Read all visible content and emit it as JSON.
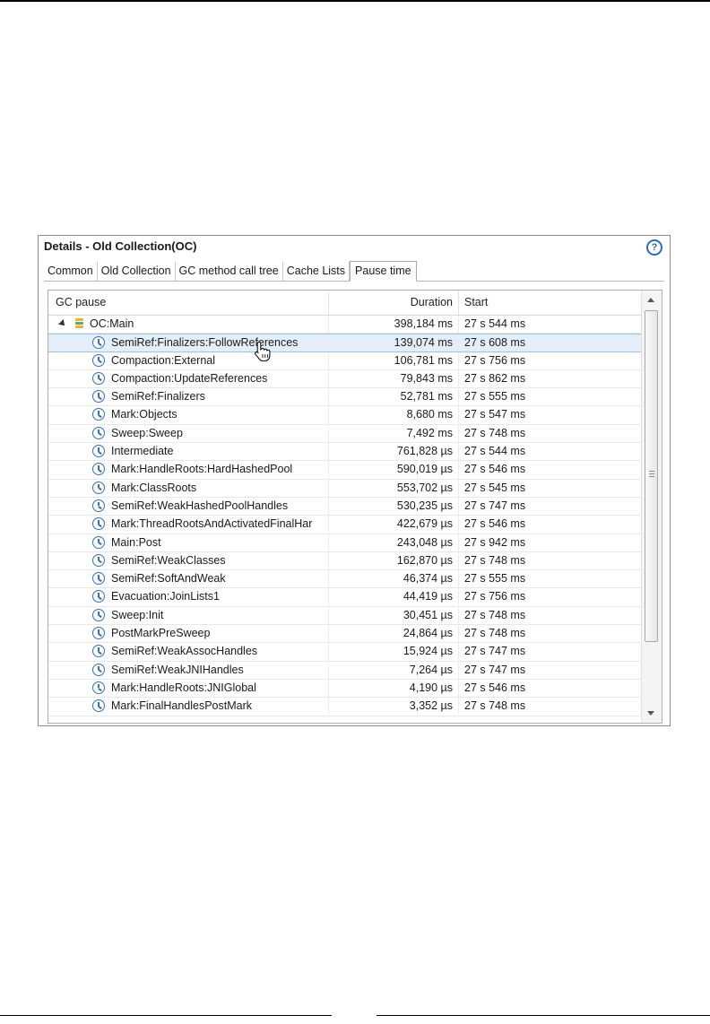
{
  "panel": {
    "title": "Details - Old Collection(OC)",
    "help_glyph": "?"
  },
  "tabs": [
    {
      "label": "Common",
      "active": false
    },
    {
      "label": "Old Collection",
      "active": false
    },
    {
      "label": "GC method call tree",
      "active": false
    },
    {
      "label": "Cache Lists",
      "active": false
    },
    {
      "label": "Pause time",
      "active": true
    }
  ],
  "table": {
    "columns": {
      "name": "GC pause",
      "duration": "Duration",
      "start": "Start"
    },
    "root": {
      "name": "OC:Main",
      "duration": "398,184 ms",
      "start": "27 s 544 ms"
    },
    "rows": [
      {
        "name": "SemiRef:Finalizers:FollowReferences",
        "duration": "139,074 ms",
        "start": "27 s 608 ms"
      },
      {
        "name": "Compaction:External",
        "duration": "106,781 ms",
        "start": "27 s 756 ms"
      },
      {
        "name": "Compaction:UpdateReferences",
        "duration": "79,843 ms",
        "start": "27 s 862 ms"
      },
      {
        "name": "SemiRef:Finalizers",
        "duration": "52,781 ms",
        "start": "27 s 555 ms"
      },
      {
        "name": "Mark:Objects",
        "duration": "8,680 ms",
        "start": "27 s 547 ms"
      },
      {
        "name": "Sweep:Sweep",
        "duration": "7,492 ms",
        "start": "27 s 748 ms"
      },
      {
        "name": "Intermediate",
        "duration": "761,828 µs",
        "start": "27 s 544 ms"
      },
      {
        "name": "Mark:HandleRoots:HardHashedPool",
        "duration": "590,019 µs",
        "start": "27 s 546 ms"
      },
      {
        "name": "Mark:ClassRoots",
        "duration": "553,702 µs",
        "start": "27 s 545 ms"
      },
      {
        "name": "SemiRef:WeakHashedPoolHandles",
        "duration": "530,235 µs",
        "start": "27 s 747 ms"
      },
      {
        "name": "Mark:ThreadRootsAndActivatedFinalHar",
        "duration": "422,679 µs",
        "start": "27 s 546 ms"
      },
      {
        "name": "Main:Post",
        "duration": "243,048 µs",
        "start": "27 s 942 ms"
      },
      {
        "name": "SemiRef:WeakClasses",
        "duration": "162,870 µs",
        "start": "27 s 748 ms"
      },
      {
        "name": "SemiRef:SoftAndWeak",
        "duration": "46,374 µs",
        "start": "27 s 555 ms"
      },
      {
        "name": "Evacuation:JoinLists1",
        "duration": "44,419 µs",
        "start": "27 s 756 ms"
      },
      {
        "name": "Sweep:Init",
        "duration": "30,451 µs",
        "start": "27 s 748 ms"
      },
      {
        "name": "PostMarkPreSweep",
        "duration": "24,864 µs",
        "start": "27 s 748 ms"
      },
      {
        "name": "SemiRef:WeakAssocHandles",
        "duration": "15,924 µs",
        "start": "27 s 747 ms"
      },
      {
        "name": "SemiRef:WeakJNIHandles",
        "duration": "7,264 µs",
        "start": "27 s 747 ms"
      },
      {
        "name": "Mark:HandleRoots:JNIGlobal",
        "duration": "4,190 µs",
        "start": "27 s 546 ms"
      },
      {
        "name": "Mark:FinalHandlesPostMark",
        "duration": "3,352 µs",
        "start": "27 s 748 ms"
      }
    ],
    "selected_index": 0,
    "icons": {
      "root": "database-icon",
      "child": "clock-icon"
    }
  },
  "colors": {
    "selection": "#e3eef9",
    "accent": "#3f72a8"
  }
}
